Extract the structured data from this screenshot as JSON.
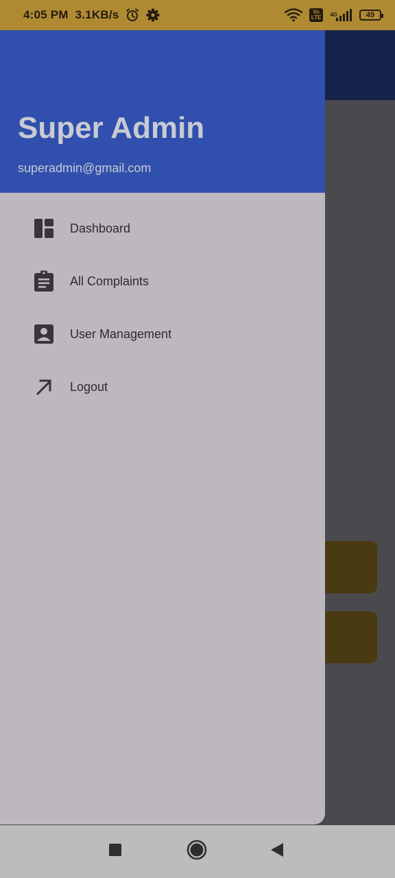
{
  "status_bar": {
    "time": "4:05 PM",
    "speed": "3.1KB/s",
    "network_label": "4G",
    "volte_top": "Vo",
    "volte_bottom": "LTE",
    "battery": "49",
    "icons": [
      "alarm-icon",
      "settings-gear-icon",
      "wifi-icon",
      "volte-icon",
      "signal-icon",
      "battery-icon"
    ]
  },
  "drawer": {
    "name": "Super Admin",
    "email": "superadmin@gmail.com",
    "header_color": "#3150ad",
    "background_color": "#bcb8bd",
    "items": [
      {
        "label": "Dashboard",
        "icon": "dashboard-icon"
      },
      {
        "label": "All Complaints",
        "icon": "clipboard-list-icon"
      },
      {
        "label": "User Management",
        "icon": "account-box-icon"
      },
      {
        "label": "Logout",
        "icon": "arrow-up-right-icon"
      }
    ]
  },
  "navigation_bar": {
    "buttons": [
      {
        "icon": "recent-apps-icon"
      },
      {
        "icon": "home-icon"
      },
      {
        "icon": "back-icon"
      }
    ]
  },
  "colors": {
    "status_bar": "#b08a33",
    "scrim": "#4a4a4e",
    "app_bar_behind": "#16234a",
    "card_behind": "#4a3a12",
    "nav_bar": "#bcbcbc"
  }
}
